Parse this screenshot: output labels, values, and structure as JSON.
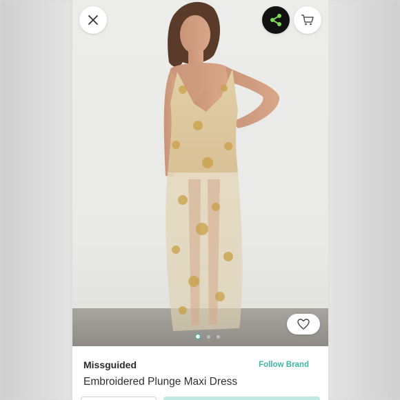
{
  "header": {
    "close_icon": "close-icon",
    "share_icon": "share-icon",
    "cart_icon": "cart-icon"
  },
  "gallery": {
    "like_icon": "heart-icon",
    "page_count": 3,
    "active_index": 0
  },
  "product": {
    "brand": "Missguided",
    "follow_label": "Follow Brand",
    "title": "Embroidered Plunge Maxi Dress"
  },
  "colors": {
    "accent": "#3cb8a4",
    "share_bg": "#111111",
    "share_icon": "#7ed957"
  }
}
